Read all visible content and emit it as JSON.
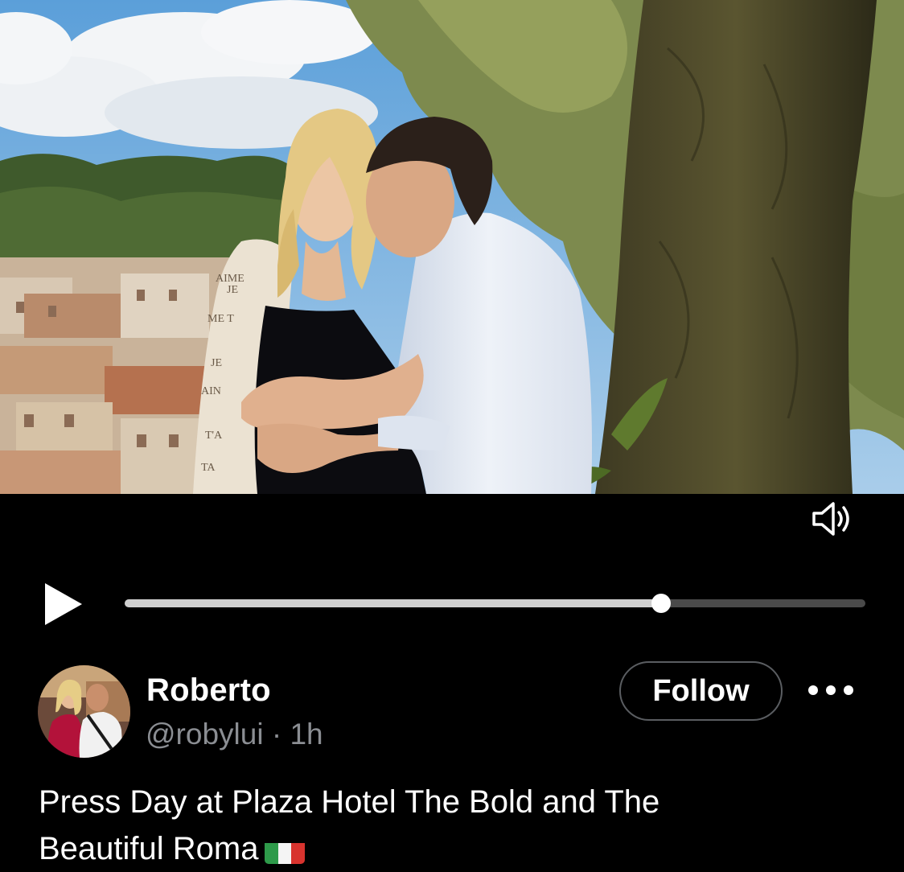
{
  "video": {
    "progress": 0.724,
    "progress_color": "#cfcfcf",
    "track_color": "#4a4a4a",
    "play_icon": "play-icon",
    "volume_icon": "speaker-volume-icon"
  },
  "post": {
    "author_name": "Roberto",
    "handle": "@robylui",
    "separator": "·",
    "time": "1h",
    "follow_label": "Follow",
    "more_icon": "more-options-icon",
    "text_line1": "Press Day at Plaza Hotel The Bold and The",
    "text_line2": "Beautiful Roma",
    "flag": "italy-flag-emoji"
  },
  "colors": {
    "background": "#000000",
    "secondary_text": "#8b8e93",
    "follow_border": "#5a5d61"
  }
}
